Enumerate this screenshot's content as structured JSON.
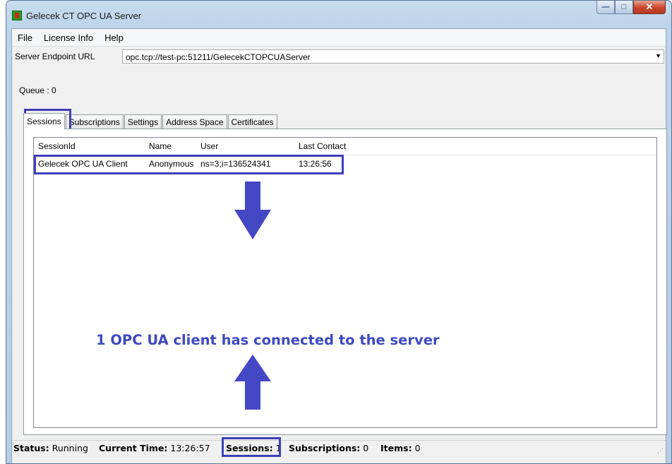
{
  "window": {
    "title": "Gelecek CT OPC UA Server"
  },
  "menu": {
    "items": [
      "File",
      "License Info",
      "Help"
    ]
  },
  "endpoint": {
    "label": "Server Endpoint URL",
    "value": "opc.tcp://test-pc:51211/GelecekCTOPCUAServer"
  },
  "queue": {
    "text": "Queue : 0"
  },
  "tabs": [
    "Sessions",
    "Subscriptions",
    "Settings",
    "Address Space",
    "Certificates"
  ],
  "sessions_table": {
    "columns": [
      "SessionId",
      "Name",
      "User",
      "Last Contact"
    ],
    "rows": [
      {
        "session_id": "Gelecek OPC UA Client",
        "name": "Anonymous",
        "user": "ns=3;i=136524341",
        "last_contact": "13:26:56"
      }
    ]
  },
  "annotation": {
    "text": "1 OPC UA client has connected to the server",
    "color": "#3e4ac0"
  },
  "status": {
    "status_label": "Status:",
    "status_value": "Running",
    "time_label": "Current Time:",
    "time_value": "13:26:57",
    "sessions_label": "Sessions:",
    "sessions_value": "1",
    "subs_label": "Subscriptions:",
    "subs_value": "0",
    "items_label": "Items:",
    "items_value": "0"
  },
  "colors": {
    "highlight": "#3d40b8",
    "arrow": "#4548c4"
  },
  "icons": [
    "app-icon",
    "minimize-icon",
    "maximize-icon",
    "close-icon",
    "dropdown-arrow-icon",
    "arrow-down-icon",
    "arrow-up-icon",
    "resize-grip-icon"
  ]
}
